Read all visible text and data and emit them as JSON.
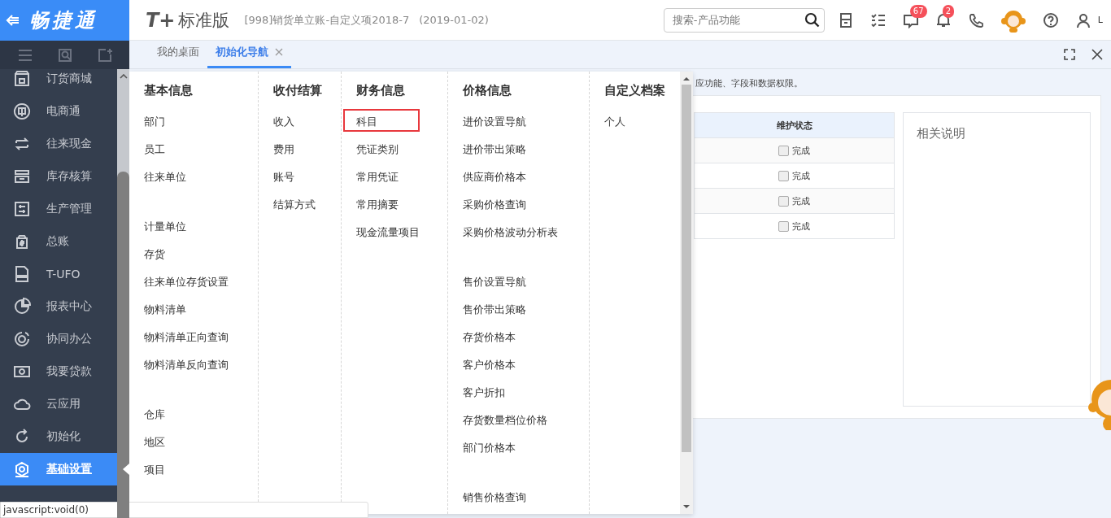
{
  "app_logo": {
    "text": "畅捷通"
  },
  "header": {
    "product_logo": "T+",
    "product_name": "标准版",
    "document_title": "[998]销货单立账-自定义项2018-7",
    "date": "(2019-01-02)",
    "search": {
      "placeholder": "搜索-产品功能"
    },
    "message_badge": "67",
    "notification_badge": "2",
    "user_label": "L"
  },
  "sidebar": {
    "items": [
      {
        "label": "订货商城",
        "selected": false
      },
      {
        "label": "电商通",
        "selected": false
      },
      {
        "label": "往来现金",
        "selected": false
      },
      {
        "label": "库存核算",
        "selected": false
      },
      {
        "label": "生产管理",
        "selected": false
      },
      {
        "label": "总账",
        "selected": false
      },
      {
        "label": "T-UFO",
        "selected": false
      },
      {
        "label": "报表中心",
        "selected": false
      },
      {
        "label": "协同办公",
        "selected": false
      },
      {
        "label": "我要贷款",
        "selected": false
      },
      {
        "label": "云应用",
        "selected": false
      },
      {
        "label": "初始化",
        "selected": false
      },
      {
        "label": "基础设置",
        "selected": true
      }
    ]
  },
  "tabs": [
    {
      "label": "我的桌面",
      "selected": false,
      "closable": false
    },
    {
      "label": "初始化导航",
      "selected": true,
      "closable": true
    }
  ],
  "page": {
    "hint": "应功能、字段和数据权限。",
    "table": {
      "columns": [
        "维护状态"
      ],
      "rows": [
        {
          "status": "完成",
          "checked": false
        },
        {
          "status": "完成",
          "checked": false
        },
        {
          "status": "完成",
          "checked": false
        },
        {
          "status": "完成",
          "checked": false
        }
      ]
    },
    "notes_title": "相关说明"
  },
  "menu": {
    "columns": [
      {
        "title": "基本信息",
        "groups": [
          [
            {
              "label": "部门",
              "selected": false
            },
            {
              "label": "员工",
              "selected": false
            },
            {
              "label": "往来单位",
              "selected": false
            }
          ],
          [
            {
              "label": "计量单位",
              "selected": false
            },
            {
              "label": "存货",
              "selected": false
            },
            {
              "label": "往来单位存货设置",
              "selected": false
            },
            {
              "label": "物料清单",
              "selected": false
            },
            {
              "label": "物料清单正向查询",
              "selected": false
            },
            {
              "label": "物料清单反向查询",
              "selected": false
            }
          ],
          [
            {
              "label": "仓库",
              "selected": false
            },
            {
              "label": "地区",
              "selected": false
            },
            {
              "label": "项目",
              "selected": false
            }
          ]
        ]
      },
      {
        "title": "收付结算",
        "groups": [
          [
            {
              "label": "收入",
              "selected": false
            },
            {
              "label": "费用",
              "selected": false
            },
            {
              "label": "账号",
              "selected": false
            },
            {
              "label": "结算方式",
              "selected": false
            }
          ]
        ]
      },
      {
        "title": "财务信息",
        "groups": [
          [
            {
              "label": "科目",
              "selected": true
            },
            {
              "label": "凭证类别",
              "selected": false
            },
            {
              "label": "常用凭证",
              "selected": false
            },
            {
              "label": "常用摘要",
              "selected": false
            },
            {
              "label": "现金流量项目",
              "selected": false
            }
          ]
        ]
      },
      {
        "title": "价格信息",
        "groups": [
          [
            {
              "label": "进价设置导航",
              "selected": false
            },
            {
              "label": "进价带出策略",
              "selected": false
            },
            {
              "label": "供应商价格本",
              "selected": false
            },
            {
              "label": "采购价格查询",
              "selected": false
            },
            {
              "label": "采购价格波动分析表",
              "selected": false
            }
          ],
          [
            {
              "label": "售价设置导航",
              "selected": false
            },
            {
              "label": "售价带出策略",
              "selected": false
            },
            {
              "label": "存货价格本",
              "selected": false
            },
            {
              "label": "客户价格本",
              "selected": false
            },
            {
              "label": "客户折扣",
              "selected": false
            },
            {
              "label": "存货数量档位价格",
              "selected": false
            },
            {
              "label": "部门价格本",
              "selected": false
            }
          ],
          [
            {
              "label": "销售价格查询",
              "selected": false
            }
          ]
        ]
      },
      {
        "title": "自定义档案",
        "groups": [
          [
            {
              "label": "个人",
              "selected": false
            }
          ]
        ]
      }
    ]
  },
  "status_bar": {
    "text": "javascript:void(0)"
  }
}
